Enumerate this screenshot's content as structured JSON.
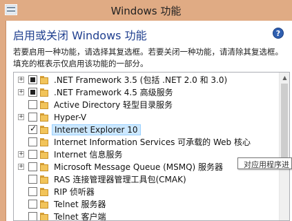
{
  "window": {
    "title": "Windows 功能",
    "icon": "windows-features-icon"
  },
  "header": {
    "heading": "启用或关闭 Windows 功能",
    "help_icon": "?",
    "description": "若要启用一种功能，请选择其复选框。若要关闭一种功能，请清除其复选框。填充的框表示仅启用该功能的一部分。"
  },
  "features": [
    {
      "label": ".NET Framework 3.5 (包括 .NET 2.0 和 3.0)",
      "expandable": true,
      "state": "partial",
      "selected": false
    },
    {
      "label": ".NET Framework 4.5 高级服务",
      "expandable": true,
      "state": "partial",
      "selected": false
    },
    {
      "label": "Active Directory 轻型目录服务",
      "expandable": false,
      "state": "unchecked",
      "selected": false
    },
    {
      "label": "Hyper-V",
      "expandable": true,
      "state": "unchecked",
      "selected": false
    },
    {
      "label": "Internet Explorer 10",
      "expandable": false,
      "state": "checked",
      "selected": true
    },
    {
      "label": "Internet Information Services 可承载的 Web 核心",
      "expandable": false,
      "state": "unchecked",
      "selected": false
    },
    {
      "label": "Internet 信息服务",
      "expandable": true,
      "state": "unchecked",
      "selected": false
    },
    {
      "label": "Microsoft Message Queue (MSMQ) 服务器",
      "expandable": true,
      "state": "unchecked",
      "selected": false
    },
    {
      "label": "RAS 连接管理器管理工具包(CMAK)",
      "expandable": false,
      "state": "unchecked",
      "selected": false
    },
    {
      "label": "RIP 侦听器",
      "expandable": false,
      "state": "unchecked",
      "selected": false
    },
    {
      "label": "Telnet 服务器",
      "expandable": false,
      "state": "unchecked",
      "selected": false
    },
    {
      "label": "Telnet 客户端",
      "expandable": false,
      "state": "unchecked",
      "selected": false
    }
  ],
  "tooltip": {
    "text": "对应用程序进"
  },
  "colors": {
    "title_bar": "#e0ab84",
    "heading": "#1f3f8f",
    "selection": "#cce8ff",
    "folder": "#f2c45a"
  }
}
